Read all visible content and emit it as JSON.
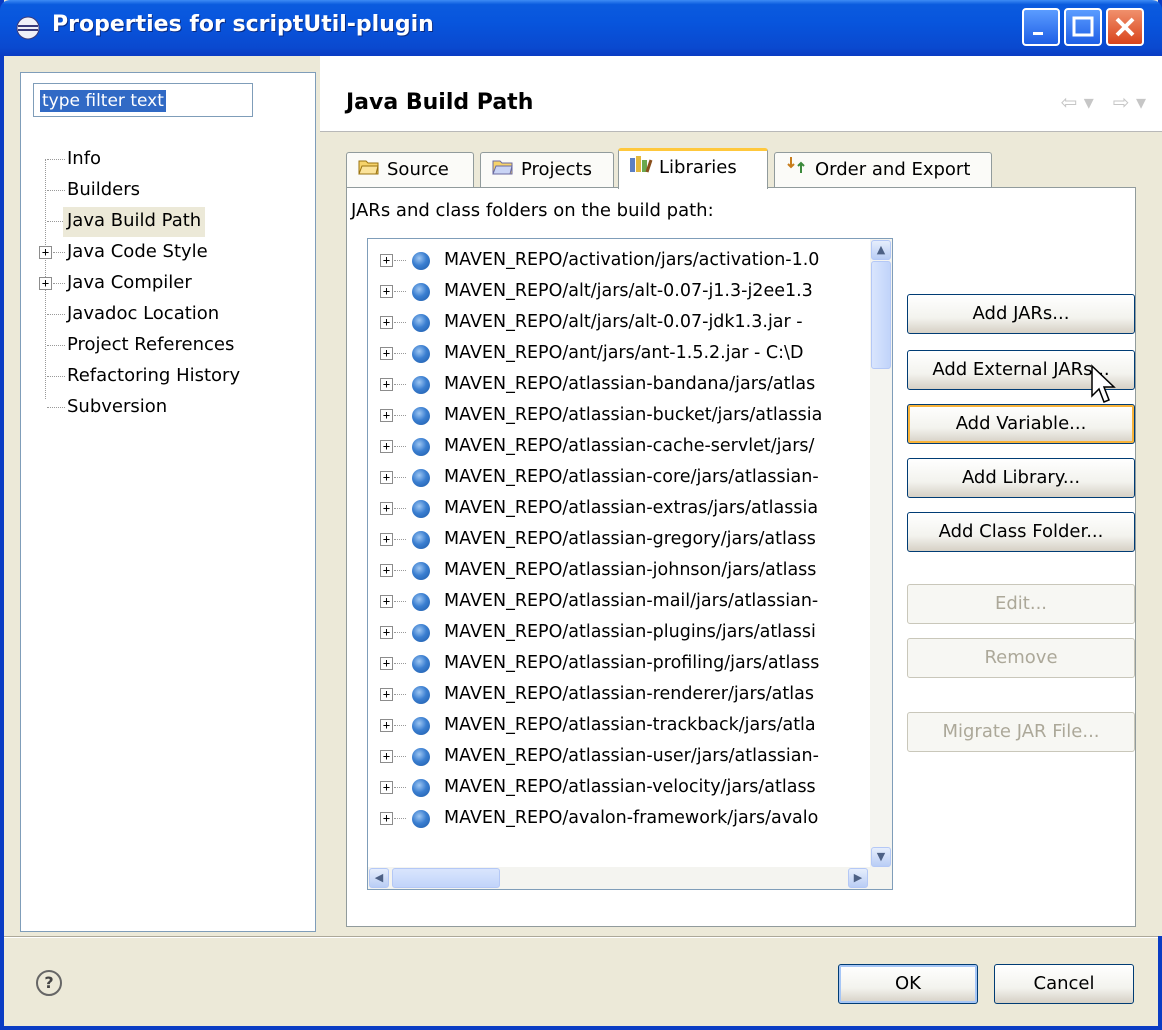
{
  "window": {
    "title": "Properties for scriptUtil-plugin",
    "accent": "#0a3cc4"
  },
  "filter": {
    "value": "type filter text"
  },
  "nav_tree": [
    {
      "label": "Info",
      "expandable": false,
      "selected": false
    },
    {
      "label": "Builders",
      "expandable": false,
      "selected": false
    },
    {
      "label": "Java Build Path",
      "expandable": false,
      "selected": true
    },
    {
      "label": "Java Code Style",
      "expandable": true,
      "selected": false
    },
    {
      "label": "Java Compiler",
      "expandable": true,
      "selected": false
    },
    {
      "label": "Javadoc Location",
      "expandable": false,
      "selected": false
    },
    {
      "label": "Project References",
      "expandable": false,
      "selected": false
    },
    {
      "label": "Refactoring History",
      "expandable": false,
      "selected": false
    },
    {
      "label": "Subversion",
      "expandable": false,
      "selected": false
    }
  ],
  "page": {
    "title": "Java Build Path",
    "back_arrow": "⇦ ▾",
    "forward_arrow": "⇨ ▾"
  },
  "tabs": [
    {
      "label": "Source",
      "icon": "source-folder-icon",
      "active": false
    },
    {
      "label": "Projects",
      "icon": "projects-folder-icon",
      "active": false
    },
    {
      "label": "Libraries",
      "icon": "libraries-icon",
      "active": true
    },
    {
      "label": "Order and Export",
      "icon": "order-export-icon",
      "active": false
    }
  ],
  "libraries": {
    "label": "JARs and class folders on the build path:",
    "entries": [
      "MAVEN_REPO/activation/jars/activation-1.0",
      "MAVEN_REPO/alt/jars/alt-0.07-j1.3-j2ee1.3",
      "MAVEN_REPO/alt/jars/alt-0.07-jdk1.3.jar - ",
      "MAVEN_REPO/ant/jars/ant-1.5.2.jar - C:\\D",
      "MAVEN_REPO/atlassian-bandana/jars/atlas",
      "MAVEN_REPO/atlassian-bucket/jars/atlassia",
      "MAVEN_REPO/atlassian-cache-servlet/jars/",
      "MAVEN_REPO/atlassian-core/jars/atlassian-",
      "MAVEN_REPO/atlassian-extras/jars/atlassia",
      "MAVEN_REPO/atlassian-gregory/jars/atlass",
      "MAVEN_REPO/atlassian-johnson/jars/atlass",
      "MAVEN_REPO/atlassian-mail/jars/atlassian-",
      "MAVEN_REPO/atlassian-plugins/jars/atlassi",
      "MAVEN_REPO/atlassian-profiling/jars/atlass",
      "MAVEN_REPO/atlassian-renderer/jars/atlas",
      "MAVEN_REPO/atlassian-trackback/jars/atla",
      "MAVEN_REPO/atlassian-user/jars/atlassian-",
      "MAVEN_REPO/atlassian-velocity/jars/atlass",
      "MAVEN_REPO/avalon-framework/jars/avalo"
    ]
  },
  "buttons": {
    "add_jars": "Add JARs...",
    "add_external_jars": "Add External JARs...",
    "add_variable": "Add Variable...",
    "add_library": "Add Library...",
    "add_class_folder": "Add Class Folder...",
    "edit": "Edit...",
    "remove": "Remove",
    "migrate_jar": "Migrate JAR File..."
  },
  "dialog": {
    "ok": "OK",
    "cancel": "Cancel",
    "help_glyph": "?"
  }
}
